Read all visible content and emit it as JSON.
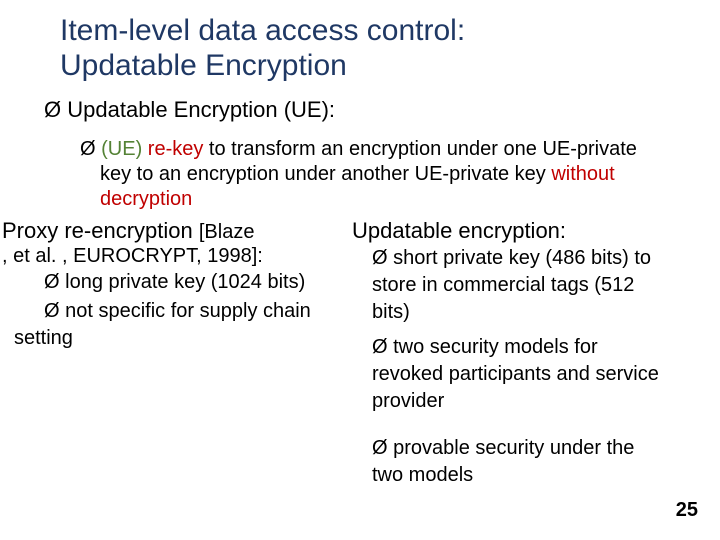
{
  "title_line1": "Item-level data access control:",
  "title_line2": "Updatable Encryption",
  "bullet_arrow": "Ø",
  "ue_heading": "Updatable Encryption (UE):",
  "ue_detail_lead": "(UE)",
  "ue_detail_rekey": " re-key",
  "ue_detail_mid1": " to transform an encryption under one UE-private key to an encryption under another UE-private key ",
  "ue_detail_without": "without decryption",
  "left": {
    "head_a": "Proxy re-encryption ",
    "head_b": "[Blaze",
    "head_c": ", et al. , EUROCRYPT, 1998]:",
    "item1": "long private key  (1024 bits)",
    "item2a": "not specific for supply  chain",
    "item2b": "setting"
  },
  "right": {
    "head": "Updatable encryption:",
    "item1a": "short private key (486 bits) to",
    "item1b": "store in commercial tags (512",
    "item1c": "bits)",
    "item2a": "two security models for",
    "item2b": "revoked participants and service",
    "item2c": "provider",
    "item3a": "provable security under the",
    "item3b": "two models"
  },
  "page_number": "25"
}
